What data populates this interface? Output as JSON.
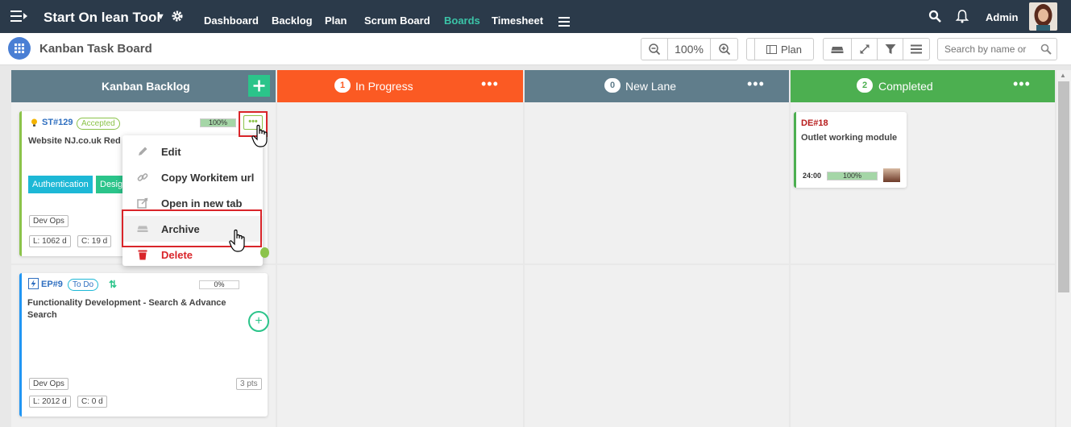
{
  "topbar": {
    "brand": "Start On lean Tool",
    "nav": [
      "Dashboard",
      "Backlog",
      "Plan",
      "Scrum Board",
      "Boards",
      "Timesheet"
    ],
    "active_nav": "Boards",
    "user": "Admin"
  },
  "subbar": {
    "title": "Kanban Task Board",
    "zoom": "100%",
    "plan_label": "Plan",
    "search_placeholder": "Search by name or"
  },
  "lanes": [
    {
      "name": "Kanban Backlog"
    },
    {
      "name": "In Progress",
      "count": "1"
    },
    {
      "name": "New Lane",
      "count": "0"
    },
    {
      "name": "Completed",
      "count": "2"
    }
  ],
  "cards": {
    "st129": {
      "id": "ST#129",
      "status": "Accepted",
      "progress": "100%",
      "title": "Website NJ.co.uk Red",
      "labels": [
        "Authentication",
        "Design"
      ],
      "team": "Dev Ops",
      "lead": "L: 1062 d",
      "cycle": "C: 19 d"
    },
    "ep9": {
      "id": "EP#9",
      "status": "To Do",
      "progress": "0%",
      "title": "Functionality Development - Search & Advance Search",
      "team": "Dev Ops",
      "points": "3 pts",
      "lead": "L: 2012 d",
      "cycle": "C: 0 d"
    },
    "de18": {
      "id": "DE#18",
      "title": "Outlet working module",
      "time": "24:00",
      "progress": "100%"
    }
  },
  "context_menu": {
    "items": [
      "Edit",
      "Copy Workitem url",
      "Open in new tab",
      "Archive",
      "Delete"
    ]
  },
  "colors": {
    "topbar": "#2b3a4a",
    "backlog": "#607d8b",
    "in_progress": "#fb5a23",
    "new_lane": "#607d8b",
    "completed": "#4caf50",
    "highlight": "#d9252a"
  }
}
